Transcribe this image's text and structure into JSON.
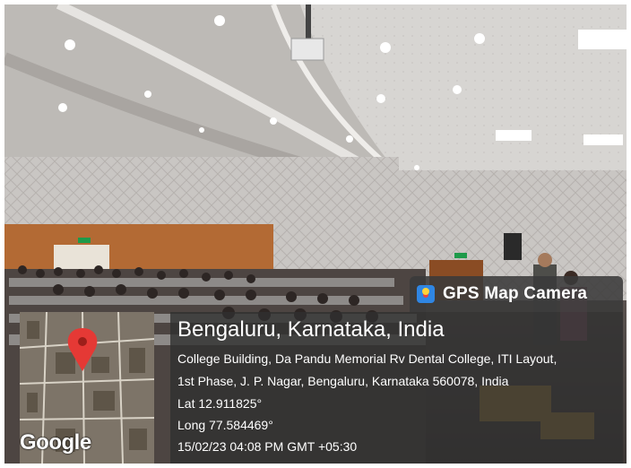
{
  "badge": {
    "title": "GPS Map Camera"
  },
  "location": {
    "city": "Bengaluru, Karnataka, India",
    "address_line1": "College Building, Da Pandu Memorial Rv Dental College, ITI Layout,",
    "address_line2": "1st Phase, J. P. Nagar, Bengaluru, Karnataka 560078, India",
    "lat": "Lat 12.911825°",
    "long": "Long 77.584469°",
    "datetime": "15/02/23 04:08 PM GMT +05:30"
  },
  "map": {
    "provider_logo": "Google",
    "marker_color": "#e53935"
  },
  "colors": {
    "overlay": "#303030",
    "badge_icon": "#2f86e3"
  }
}
